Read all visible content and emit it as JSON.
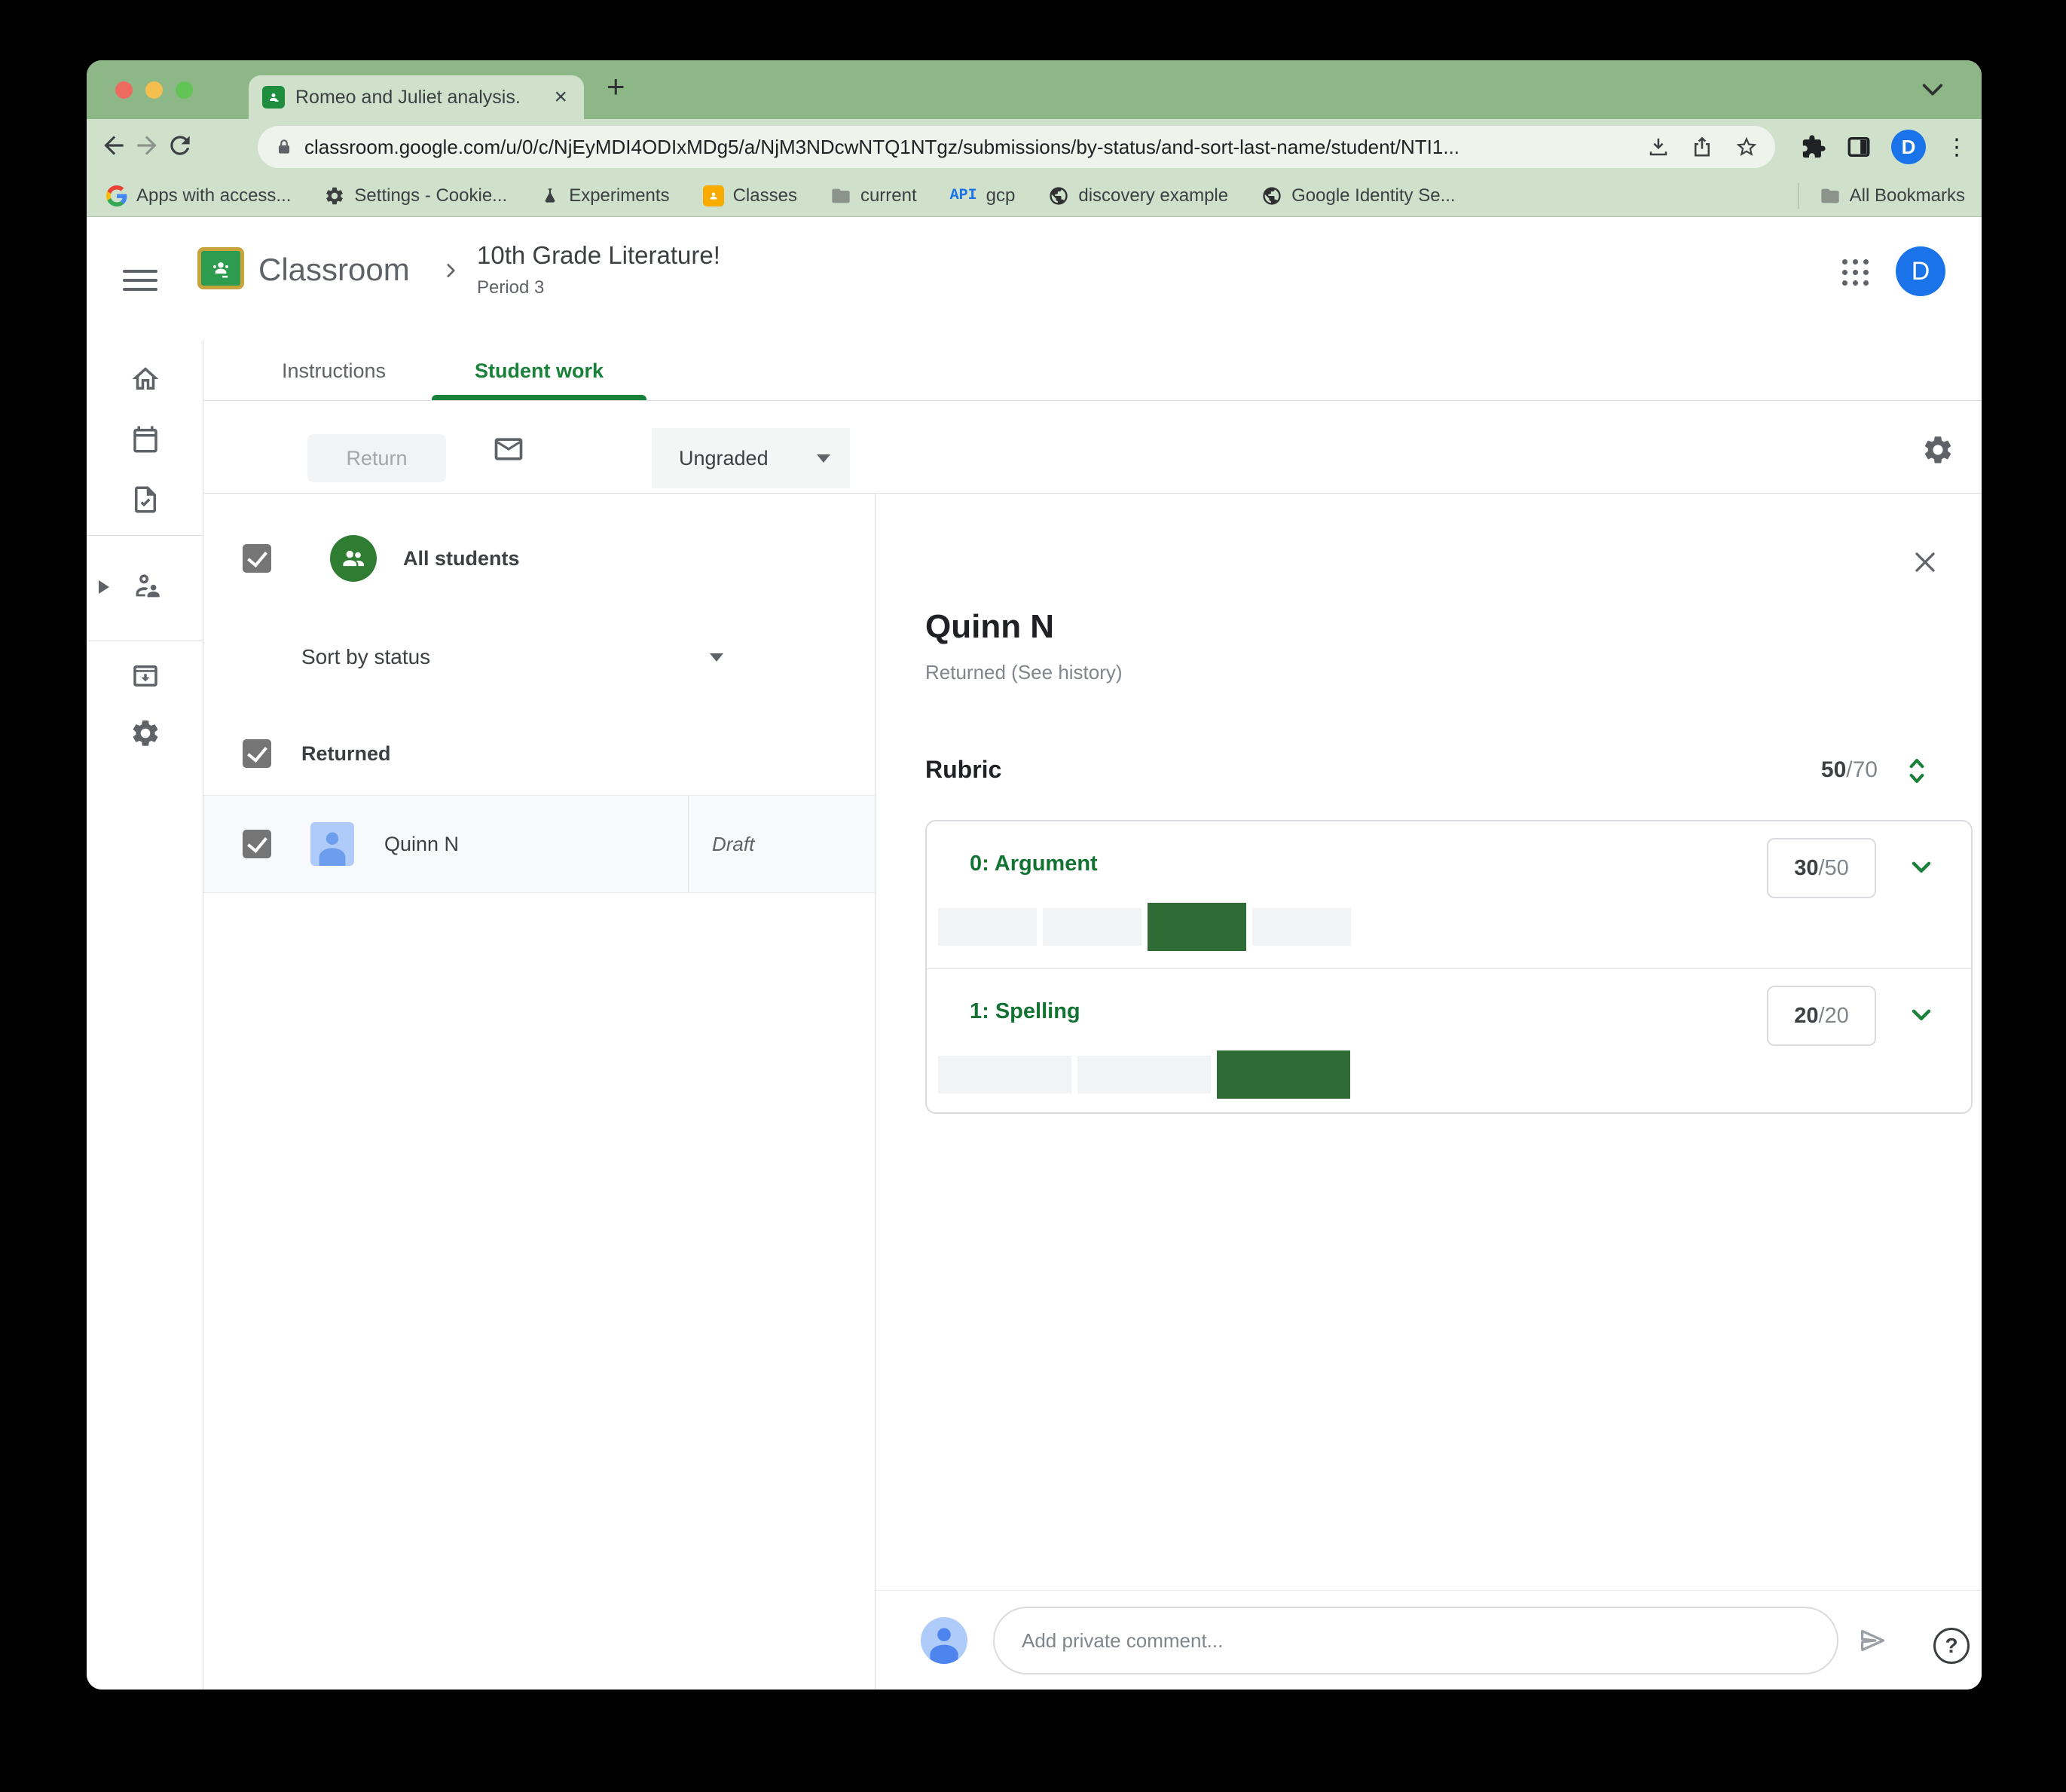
{
  "browser": {
    "tab_title": "Romeo and Juliet analysis.",
    "url": "classroom.google.com/u/0/c/NjEyMDI4ODIxMDg5/a/NjM3NDcwNTQ1NTgz/submissions/by-status/and-sort-last-name/student/NTI1...",
    "profile_initial": "D",
    "bookmarks": [
      {
        "icon": "google-g-icon",
        "label": "Apps with access..."
      },
      {
        "icon": "gear-icon",
        "label": "Settings - Cookie..."
      },
      {
        "icon": "flask-icon",
        "label": "Experiments"
      },
      {
        "icon": "classroom-icon",
        "label": "Classes"
      },
      {
        "icon": "folder-icon",
        "label": "current"
      },
      {
        "icon": "api-icon",
        "label": "gcp"
      },
      {
        "icon": "globe-icon",
        "label": "discovery example"
      },
      {
        "icon": "globe-icon",
        "label": "Google Identity Se..."
      }
    ],
    "all_bookmarks_label": "All Bookmarks"
  },
  "header": {
    "app_name": "Classroom",
    "course_title": "10th Grade Literature!",
    "course_period": "Period 3",
    "profile_initial": "D"
  },
  "tabs": {
    "instructions": "Instructions",
    "student_work": "Student work"
  },
  "toolbar": {
    "return_label": "Return",
    "status_filter": "Ungraded"
  },
  "students_panel": {
    "all_students_label": "All students",
    "sort_label": "Sort by status",
    "group_label": "Returned",
    "student_name": "Quinn N",
    "student_work_status": "Draft"
  },
  "detail": {
    "student_name": "Quinn N",
    "status_line": "Returned (See history)",
    "rubric_label": "Rubric",
    "rubric_score": "50",
    "rubric_total": "/70",
    "criteria": [
      {
        "title": "0: Argument",
        "score": "30",
        "total": "/50",
        "segments": 4,
        "selected_index": 2
      },
      {
        "title": "1: Spelling",
        "score": "20",
        "total": "/20",
        "segments": 3,
        "selected_index": 2
      }
    ],
    "comment_placeholder": "Add private comment..."
  },
  "colors": {
    "accent_green": "#188038",
    "criterion_green": "#137333",
    "segment_green": "#2f6b35",
    "titlebar_green": "#8db787",
    "chrome_green": "#cfe1cb",
    "profile_blue": "#1a73e8"
  }
}
